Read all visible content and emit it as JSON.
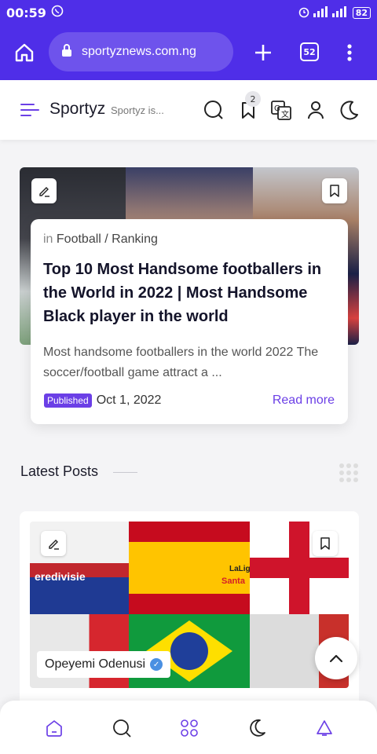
{
  "status_bar": {
    "time": "00:59",
    "battery": "82"
  },
  "browser": {
    "url": "sportyznews.com.ng",
    "tab_count": "52"
  },
  "site_header": {
    "brand": "Sportyz",
    "tagline": "Sportyz is...",
    "saved_count": "2"
  },
  "featured": {
    "category_prefix": "in",
    "category": "Football / Ranking",
    "title": "Top 10 Most Handsome footballers in the World in 2022 | Most Handsome Black player in the world",
    "excerpt": "Most handsome footballers in the world 2022 The soccer/football game attract a ...",
    "status": "Published",
    "date": "Oct 1, 2022",
    "read_more": "Read more"
  },
  "latest": {
    "title": "Latest Posts",
    "post": {
      "author": "Opeyemi Odenusi",
      "logo_eredivisie": "eredivisie",
      "logo_laliga": "LaLiga",
      "logo_santander": "Santa"
    }
  },
  "colors": {
    "accent": "#6b3fe6",
    "browser": "#4f2ee8"
  },
  "icons": {
    "home": "home-icon",
    "search": "search-icon",
    "bookmark": "bookmark-icon",
    "translate": "translate-icon",
    "user": "user-icon",
    "moon": "moon-icon",
    "menu": "menu-icon",
    "apps": "apps-icon",
    "bell": "bell-icon"
  }
}
